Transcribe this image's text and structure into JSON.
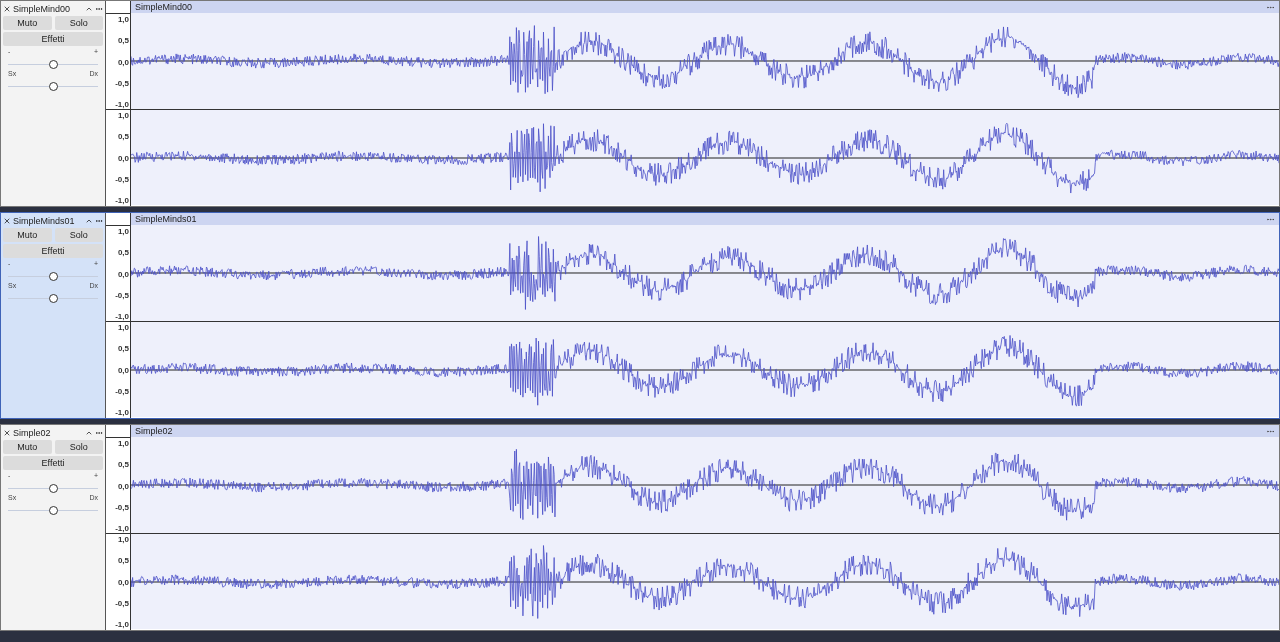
{
  "tracks": [
    {
      "name": "SimpleMind00",
      "selected": false,
      "mute": "Muto",
      "solo": "Solo",
      "effects": "Effetti",
      "gain": {
        "min": "-",
        "max": "+",
        "level": 0.5
      },
      "pan": {
        "min": "Sx",
        "max": "Dx",
        "level": 0.5
      },
      "clip": {
        "title": "SimpleMind00"
      },
      "channels": [
        {
          "scale": [
            "1,0",
            "0,5",
            "0,0",
            "-0,5",
            "-1,0"
          ]
        },
        {
          "scale": [
            "1,0",
            "0,5",
            "0,0",
            "-0,5",
            "-1,0"
          ]
        }
      ]
    },
    {
      "name": "SimpleMinds01",
      "selected": true,
      "mute": "Muto",
      "solo": "Solo",
      "effects": "Effetti",
      "gain": {
        "min": "-",
        "max": "+",
        "level": 0.5
      },
      "pan": {
        "min": "Sx",
        "max": "Dx",
        "level": 0.5
      },
      "clip": {
        "title": "SimpleMinds01"
      },
      "channels": [
        {
          "scale": [
            "1,0",
            "0,5",
            "0,0",
            "-0,5",
            "-1,0"
          ]
        },
        {
          "scale": [
            "1,0",
            "0,5",
            "0,0",
            "-0,5",
            "-1,0"
          ]
        }
      ]
    },
    {
      "name": "Simple02",
      "selected": false,
      "mute": "Muto",
      "solo": "Solo",
      "effects": "Effetti",
      "gain": {
        "min": "-",
        "max": "+",
        "level": 0.5
      },
      "pan": {
        "min": "Sx",
        "max": "Dx",
        "level": 0.5
      },
      "clip": {
        "title": "Simple02"
      },
      "channels": [
        {
          "scale": [
            "1,0",
            "0,5",
            "0,0",
            "-0,5",
            "-1,0"
          ]
        },
        {
          "scale": [
            "1,0",
            "0,5",
            "0,0",
            "-0,5",
            "-1,0"
          ]
        }
      ]
    }
  ]
}
